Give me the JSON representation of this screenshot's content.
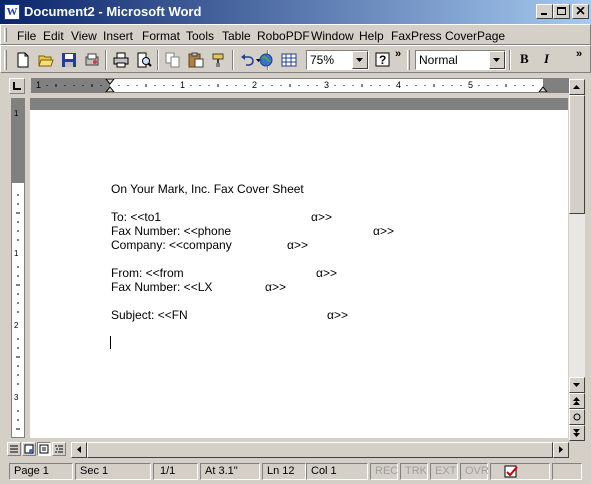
{
  "window": {
    "title": "Document2 - Microsoft Word",
    "app_icon_letter": "W"
  },
  "menu": {
    "items": [
      "File",
      "Edit",
      "View",
      "Insert",
      "Format",
      "Tools",
      "Table",
      "RoboPDF",
      "Window",
      "Help",
      "FaxPress CoverPage"
    ]
  },
  "toolbar": {
    "zoom": "75%",
    "style": "Normal",
    "help_label": "?",
    "bold_label": "B",
    "italic_label": "I",
    "overflow_label": "»",
    "buttons": [
      "new-icon",
      "open-icon",
      "save-icon",
      "permission-icon",
      "print-icon",
      "print-preview-icon",
      "copy-icon",
      "paste-icon",
      "format-painter-icon",
      "undo-icon",
      "web-icon",
      "table-icon"
    ]
  },
  "ruler": {
    "numbers": [
      "1",
      "1",
      "2",
      "3",
      "4",
      "5"
    ],
    "vertical_numbers": [
      "1",
      "1",
      "2",
      "3"
    ]
  },
  "document": {
    "lines": [
      {
        "text": "On Your Mark, Inc. Fax Cover Sheet",
        "mark": ""
      },
      {
        "text": "To: <<to1",
        "mark": "α>>"
      },
      {
        "text": "Fax Number: <<phone",
        "mark": "α>>"
      },
      {
        "text": "Company: <<company",
        "mark": "α>>"
      },
      {
        "text": "From: <<from",
        "mark": "α>>"
      },
      {
        "text": "Fax Number: <<LX",
        "mark": "α>>"
      },
      {
        "text": "Subject: <<FN",
        "mark": "α>>"
      }
    ]
  },
  "status": {
    "page": "Page  1",
    "section": "Sec  1",
    "pages": "1/1",
    "at": "At  3.1\"",
    "line": "Ln  12",
    "col": "Col  1",
    "rec": "REC",
    "trk": "TRK",
    "ext": "EXT",
    "ovr": "OVR"
  },
  "colors": {
    "titlebar_start": "#0a246a",
    "titlebar_end": "#a6caf0",
    "chrome": "#d4d0c8"
  }
}
